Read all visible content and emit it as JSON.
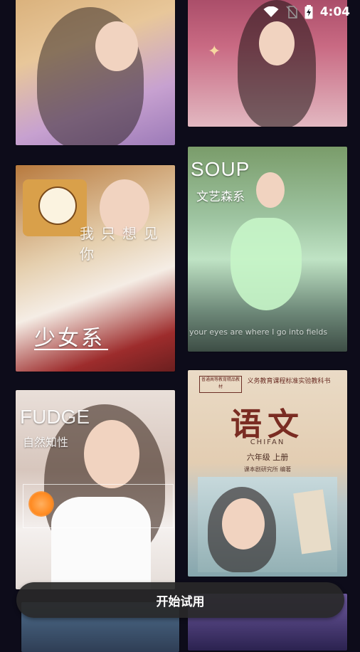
{
  "status_bar": {
    "time": "4:04",
    "icons": [
      "wifi-icon",
      "no-sim-icon",
      "battery-charging-icon"
    ]
  },
  "cards": [
    {
      "id": "c1",
      "texts": []
    },
    {
      "id": "c2",
      "texts": []
    },
    {
      "id": "c3",
      "texts": [
        "我只想见你",
        "少女系"
      ]
    },
    {
      "id": "c4",
      "texts": [
        "SOUP",
        "文艺森系",
        "your eyes are where I go into fields"
      ]
    },
    {
      "id": "c5",
      "texts": [
        "FUDGE",
        "自然知性"
      ]
    },
    {
      "id": "c6",
      "texts": [
        "语文",
        "CHIFAN",
        "六年级 上册",
        "义务教育课程标准实验教科书",
        "课本剧研究所 编著"
      ]
    },
    {
      "id": "c7",
      "texts": []
    },
    {
      "id": "c8",
      "texts": []
    }
  ],
  "c3": {
    "wish": "我只想见你",
    "label": "少女系"
  },
  "c4": {
    "title": "SOUP",
    "subtitle": "文艺森系",
    "caption": "your eyes are where I go into fields"
  },
  "c5": {
    "title": "FUDGE",
    "subtitle": "自然知性"
  },
  "c6": {
    "header": "义务教育课程标准实验教科书",
    "title": "语文",
    "subtitle": "CHIFAN",
    "grade": "六年级 上册",
    "publisher": "课本剧研究所 编著",
    "stamp": "普通高等教育精品教材"
  },
  "cta": {
    "label": "开始试用"
  }
}
